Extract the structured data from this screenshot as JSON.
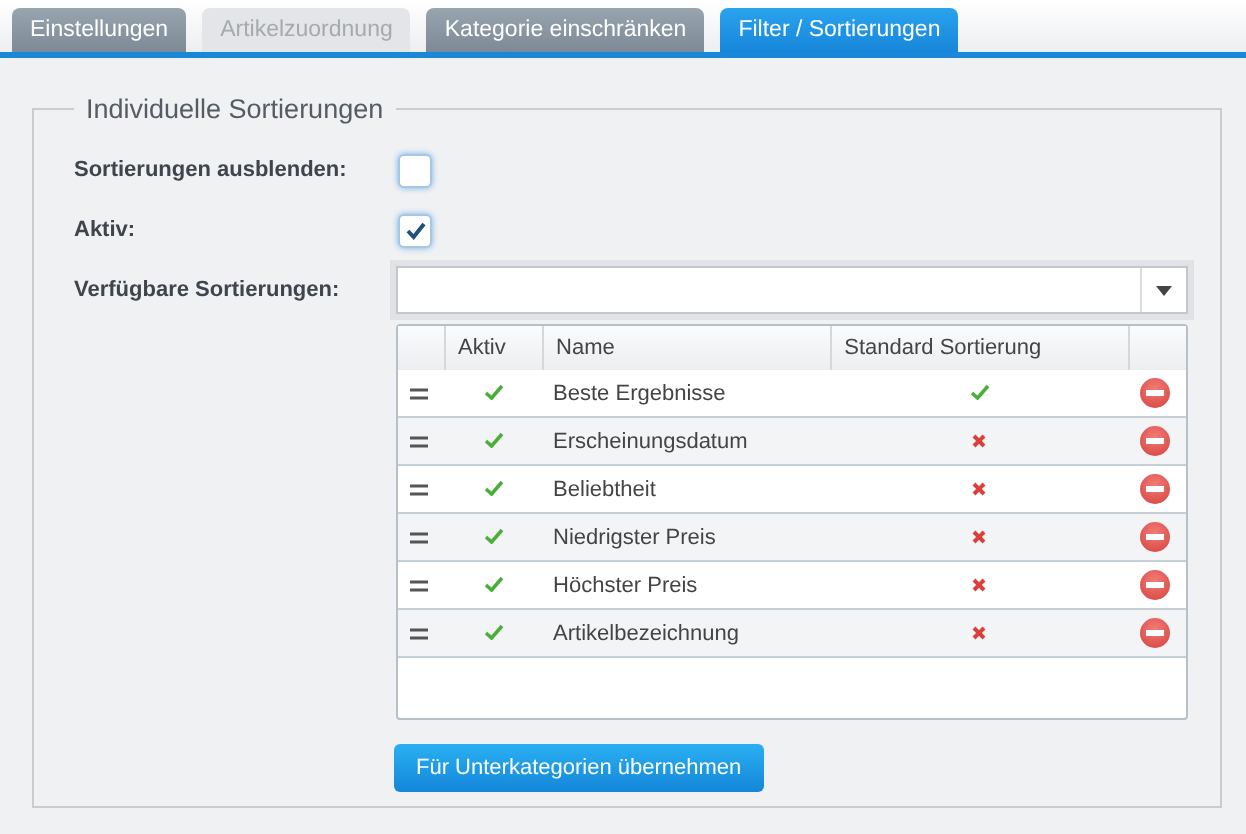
{
  "tabs": [
    {
      "label": "Einstellungen",
      "selected": false,
      "disabled": false
    },
    {
      "label": "Artikelzuordnung",
      "selected": false,
      "disabled": true
    },
    {
      "label": "Kategorie einschränken",
      "selected": false,
      "disabled": false
    },
    {
      "label": "Filter / Sortierungen",
      "selected": true,
      "disabled": false
    }
  ],
  "fieldset": {
    "legend": "Individuelle Sortierungen",
    "fields": [
      {
        "kind": "checkbox",
        "label": "Sortierungen ausblenden:",
        "checked": false
      },
      {
        "kind": "checkbox",
        "label": "Aktiv:",
        "checked": true
      },
      {
        "kind": "select",
        "label": "Verfügbare Sortierungen:"
      }
    ],
    "table": {
      "columns": [
        "Aktiv",
        "Name",
        "Standard Sortierung"
      ],
      "rows": [
        {
          "active": true,
          "name": "Beste Ergebnisse",
          "default": true
        },
        {
          "active": true,
          "name": "Erscheinungsdatum",
          "default": false
        },
        {
          "active": true,
          "name": "Beliebtheit",
          "default": false
        },
        {
          "active": true,
          "name": "Niedrigster Preis",
          "default": false
        },
        {
          "active": true,
          "name": "Höchster Preis",
          "default": false
        },
        {
          "active": true,
          "name": "Artikelbezeichnung",
          "default": false
        }
      ]
    },
    "button": "Für Unterkategorien übernehmen"
  }
}
